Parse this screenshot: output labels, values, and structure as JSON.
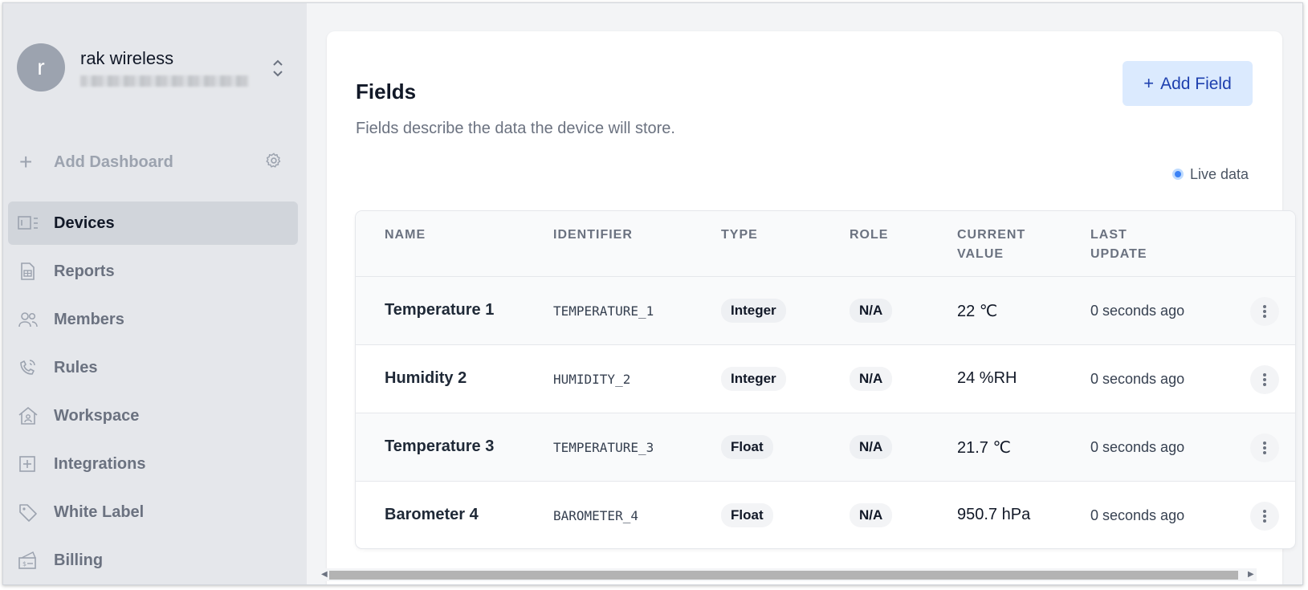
{
  "org": {
    "initial": "r",
    "name": "rak wireless"
  },
  "sidebar": {
    "add_dashboard": "Add Dashboard",
    "items": [
      {
        "label": "Devices",
        "icon": "devices-icon",
        "active": true
      },
      {
        "label": "Reports",
        "icon": "reports-icon"
      },
      {
        "label": "Members",
        "icon": "members-icon"
      },
      {
        "label": "Rules",
        "icon": "rules-icon"
      },
      {
        "label": "Workspace",
        "icon": "workspace-icon"
      },
      {
        "label": "Integrations",
        "icon": "integrations-icon"
      },
      {
        "label": "White Label",
        "icon": "tag-icon"
      },
      {
        "label": "Billing",
        "icon": "billing-icon"
      }
    ]
  },
  "fields": {
    "title": "Fields",
    "description": "Fields describe the data the device will store.",
    "add_label": "Add Field",
    "live_label": "Live data",
    "columns": [
      "NAME",
      "IDENTIFIER",
      "TYPE",
      "ROLE",
      "CURRENT\nVALUE",
      "LAST\nUPDATE"
    ],
    "rows": [
      {
        "name": "Temperature 1",
        "identifier": "TEMPERATURE_1",
        "type": "Integer",
        "role": "N/A",
        "value": "22 ℃",
        "updated": "0 seconds ago"
      },
      {
        "name": "Humidity 2",
        "identifier": "HUMIDITY_2",
        "type": "Integer",
        "role": "N/A",
        "value": "24 %RH",
        "updated": "0 seconds ago"
      },
      {
        "name": "Temperature 3",
        "identifier": "TEMPERATURE_3",
        "type": "Float",
        "role": "N/A",
        "value": "21.7 ℃",
        "updated": "0 seconds ago"
      },
      {
        "name": "Barometer 4",
        "identifier": "BAROMETER_4",
        "type": "Float",
        "role": "N/A",
        "value": "950.7 hPa",
        "updated": "0 seconds ago"
      }
    ]
  },
  "colors": {
    "accent": "#3b82f6",
    "sidebar_bg": "#e5e7eb",
    "active_item_bg": "#d1d5db",
    "add_button_bg": "#dbeafe"
  }
}
